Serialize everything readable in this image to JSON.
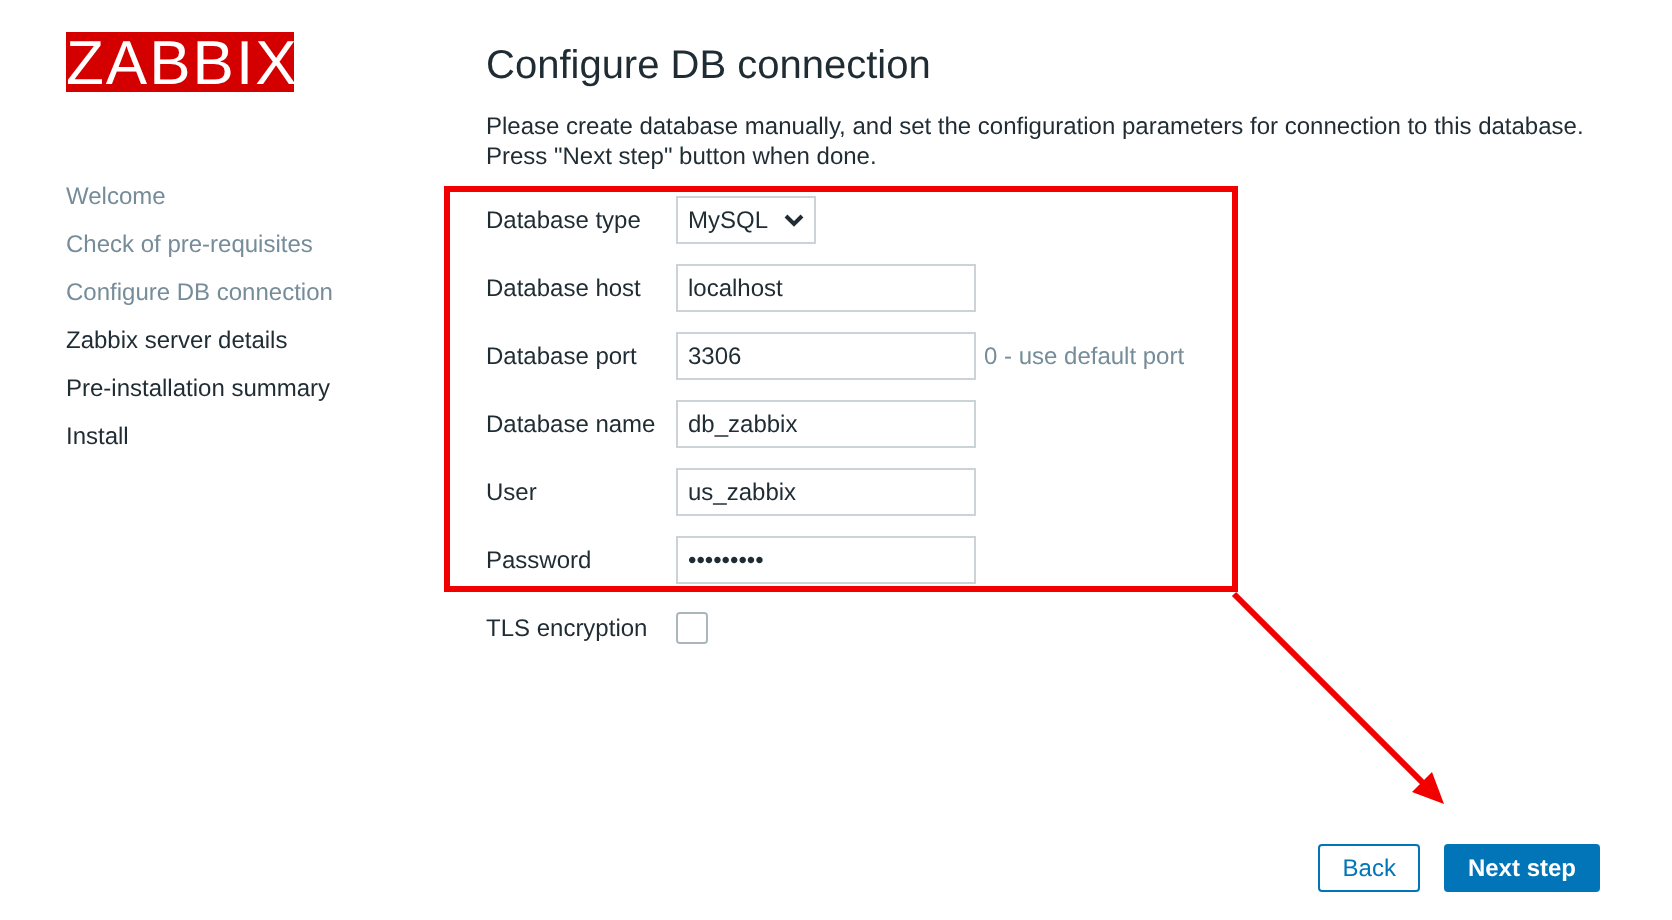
{
  "logo": {
    "text": "ZABBIX"
  },
  "steps": [
    {
      "label": "Welcome",
      "done": true
    },
    {
      "label": "Check of pre-requisites",
      "done": true
    },
    {
      "label": "Configure DB connection",
      "done": true
    },
    {
      "label": "Zabbix server details",
      "done": false
    },
    {
      "label": "Pre-installation summary",
      "done": false
    },
    {
      "label": "Install",
      "done": false
    }
  ],
  "title": "Configure DB connection",
  "description": [
    "Please create database manually, and set the configuration parameters for connection to this database.",
    "Press \"Next step\" button when done."
  ],
  "fields": [
    {
      "kind": "select",
      "label": "Database type",
      "value": "MySQL"
    },
    {
      "kind": "text",
      "label": "Database host",
      "value": "localhost"
    },
    {
      "kind": "text",
      "label": "Database port",
      "value": "3306",
      "hint": "0 - use default port"
    },
    {
      "kind": "text",
      "label": "Database name",
      "value": "db_zabbix"
    },
    {
      "kind": "text",
      "label": "User",
      "value": "us_zabbix"
    },
    {
      "kind": "text",
      "label": "Password",
      "value": "•••••••••"
    },
    {
      "kind": "checkbox",
      "label": "TLS encryption",
      "checked": false
    }
  ],
  "buttons": [
    {
      "label": "Back",
      "primary": false
    },
    {
      "label": "Next step",
      "primary": true
    }
  ]
}
